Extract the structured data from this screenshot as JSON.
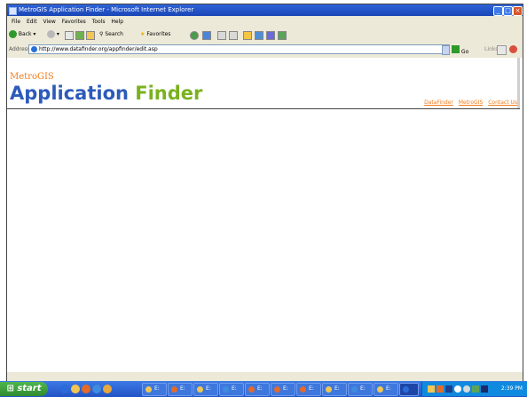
{
  "window": {
    "title": "MetroGIS Application Finder - Microsoft Internet Explorer",
    "controls": {
      "minimize": "_",
      "maximize": "□",
      "close": "×"
    }
  },
  "menu": [
    "File",
    "Edit",
    "View",
    "Favorites",
    "Tools",
    "Help"
  ],
  "toolbar": {
    "back": "Back",
    "search": "Search",
    "favorites": "Favorites"
  },
  "address": {
    "label": "Address",
    "url": "http://www.datafinder.org/appfinder/edit.asp",
    "go": "Go",
    "links": "Links"
  },
  "page": {
    "brand_small": "MetroGIS",
    "brand_word1": "Application",
    "brand_word2": "Finder",
    "nav": [
      "DataFinder",
      "MetroGIS",
      "Contact Us"
    ]
  },
  "taskbar": {
    "start": "start",
    "tasks": [
      "E:",
      "E:",
      "E:",
      "E:",
      "E:",
      "E:",
      "E:",
      "E:",
      "E:",
      "E:"
    ],
    "clock": "2:39 PM"
  },
  "colors": {
    "brand_orange": "#f07c1c",
    "brand_blue": "#2d5bb9",
    "brand_green": "#7ab21f",
    "titlebar": "#1a46b6",
    "start_green": "#2f8b2f"
  }
}
